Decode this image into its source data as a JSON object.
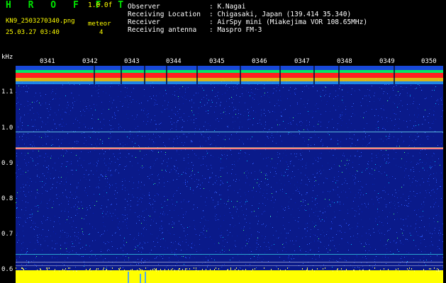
{
  "header": {
    "app_name": "H R O F F T",
    "version": "1.0.0f",
    "filename": "KN9_2503270340.png",
    "meteor_label": "meteor",
    "meteor_count": "4",
    "datetime": "25.03.27 03:40"
  },
  "info": {
    "observer_label": "Observer",
    "observer_value": ": K.Nagai",
    "location_label": "Receiving Location",
    "location_value": ": Chigasaki, Japan (139.414 35.340)",
    "receiver_label": "Receiver",
    "receiver_value": ": AirSpy mini (Miakejima VOR 108.65MHz)",
    "antenna_label": "Receiving antenna",
    "antenna_value": ": Maspro FM-3"
  },
  "y_axis": {
    "unit": "kHz",
    "ticks": [
      "1.1",
      "1.0",
      "0.9",
      "0.8",
      "0.7",
      "0.6"
    ]
  },
  "x_axis": {
    "ticks": [
      "0341",
      "0342",
      "0343",
      "0344",
      "0345",
      "0346",
      "0347",
      "0348",
      "0349",
      "0350"
    ]
  },
  "colors": {
    "background": "#000000",
    "noise_base": "#0a1a8a",
    "band_top": "#ff2020",
    "band_mid": "#00ff60",
    "carrier": "#ff8080",
    "yellow_noise": "#ffff00",
    "text_green": "#00e400",
    "text_yellow": "#ffff00",
    "text_white": "#ffffff"
  }
}
